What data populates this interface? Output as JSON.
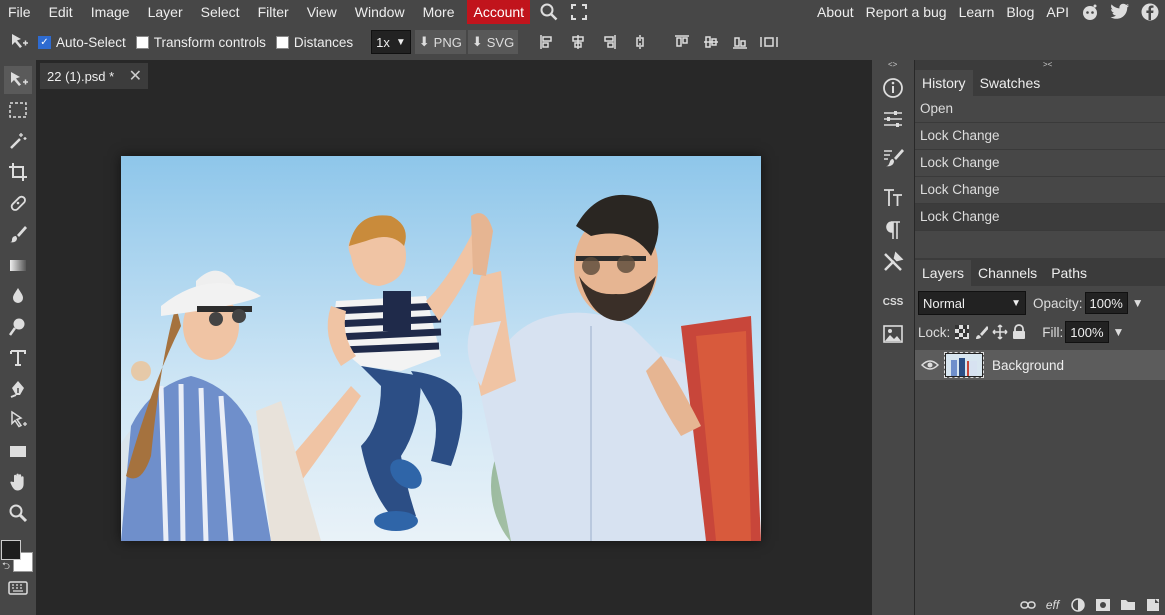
{
  "menu": {
    "items": [
      "File",
      "Edit",
      "Image",
      "Layer",
      "Select",
      "Filter",
      "View",
      "Window",
      "More"
    ],
    "account": "Account",
    "right_items": [
      "About",
      "Report a bug",
      "Learn",
      "Blog",
      "API"
    ]
  },
  "options": {
    "auto_select": "Auto-Select",
    "auto_select_checked": true,
    "transform_controls": "Transform controls",
    "distances": "Distances",
    "zoom": "1x",
    "png": "PNG",
    "svg": "SVG"
  },
  "document": {
    "tab_title": "22 (1).psd *"
  },
  "history": {
    "tabs": [
      "History",
      "Swatches"
    ],
    "items": [
      "Open",
      "Lock Change",
      "Lock Change",
      "Lock Change",
      "Lock Change"
    ]
  },
  "layers": {
    "tabs": [
      "Layers",
      "Channels",
      "Paths"
    ],
    "blend_mode": "Normal",
    "opacity_label": "Opacity:",
    "opacity": "100%",
    "lock_label": "Lock:",
    "fill_label": "Fill:",
    "fill": "100%",
    "rows": [
      {
        "name": "Background"
      }
    ]
  },
  "rail": {
    "css": "CSS"
  },
  "footer": {
    "eff": "eff"
  },
  "colors": {
    "accent": "#c1141c",
    "checkbox": "#2e6bd1"
  }
}
